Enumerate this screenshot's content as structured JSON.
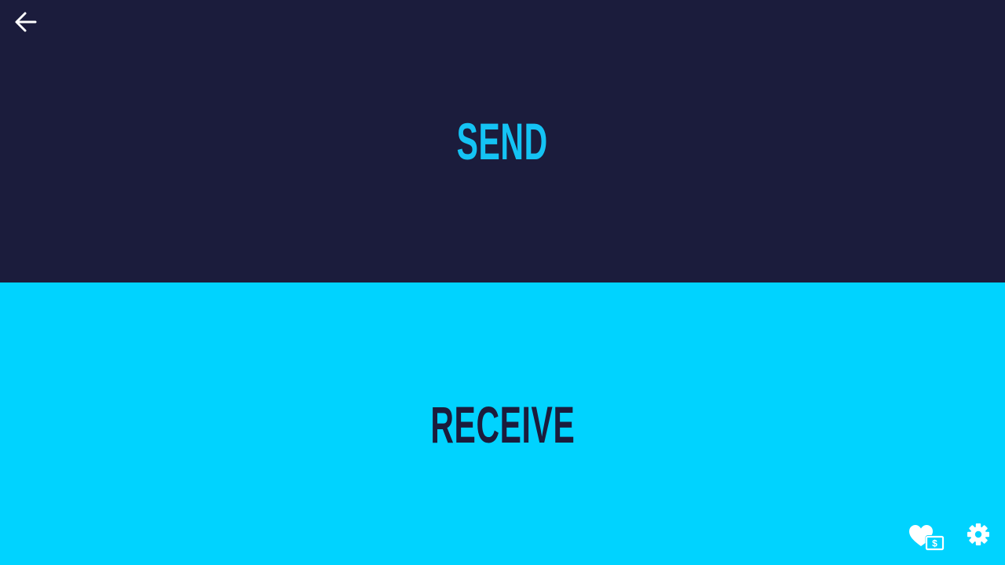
{
  "send": {
    "label": "SEND",
    "background": "#1b1c3c",
    "text_color": "#14c3f4"
  },
  "receive": {
    "label": "RECEIVE",
    "background": "#00d3ff",
    "text_color": "#1b1c3c"
  },
  "icons": {
    "back": "arrow-left-icon",
    "donate": "heart-money-icon",
    "settings": "gear-icon"
  }
}
